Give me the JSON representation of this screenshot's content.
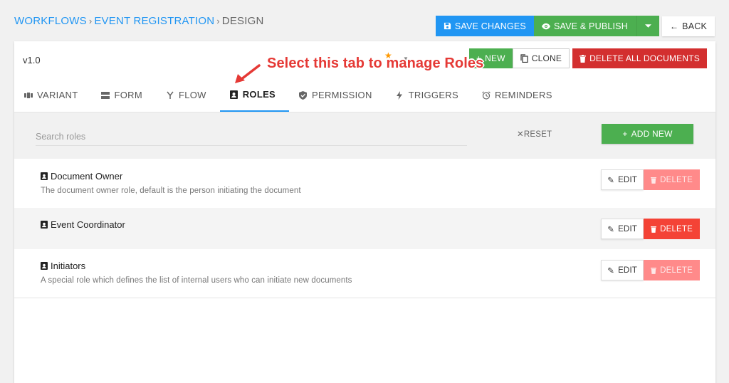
{
  "breadcrumb": {
    "items": [
      "WORKFLOWS",
      "EVENT REGISTRATION"
    ],
    "current": "DESIGN"
  },
  "top_actions": {
    "save_changes": "SAVE CHANGES",
    "save_publish": "SAVE & PUBLISH",
    "back": "BACK"
  },
  "panel": {
    "version": "v1.0",
    "new": "NEW",
    "clone": "CLONE",
    "delete_all": "DELETE ALL DOCUMENTS"
  },
  "annotation": "Select this tab to manage Roles",
  "tabs": [
    {
      "label": "VARIANT",
      "icon": "variant-icon",
      "active": false
    },
    {
      "label": "FORM",
      "icon": "form-icon",
      "active": false
    },
    {
      "label": "FLOW",
      "icon": "flow-icon",
      "active": false
    },
    {
      "label": "ROLES",
      "icon": "role-badge-icon",
      "active": true
    },
    {
      "label": "PERMISSION",
      "icon": "shield-check-icon",
      "active": false
    },
    {
      "label": "TRIGGERS",
      "icon": "lightning-icon",
      "active": false
    },
    {
      "label": "REMINDERS",
      "icon": "alarm-clock-icon",
      "active": false
    }
  ],
  "filter": {
    "search_placeholder": "Search roles",
    "reset": "RESET",
    "add_new": "ADD NEW"
  },
  "roles": [
    {
      "name": "Document Owner",
      "description": "The document owner role, default is the person initiating the document",
      "edit": "EDIT",
      "delete": "DELETE",
      "delete_enabled": false
    },
    {
      "name": "Event Coordinator",
      "description": "",
      "edit": "EDIT",
      "delete": "DELETE",
      "delete_enabled": true
    },
    {
      "name": "Initiators",
      "description": "A special role which defines the list of internal users who can initiate new documents",
      "edit": "EDIT",
      "delete": "DELETE",
      "delete_enabled": false
    }
  ],
  "colors": {
    "primary_blue": "#2196f3",
    "green": "#4caf50",
    "red": "#d32f2f",
    "annotation_red": "#e53935"
  }
}
